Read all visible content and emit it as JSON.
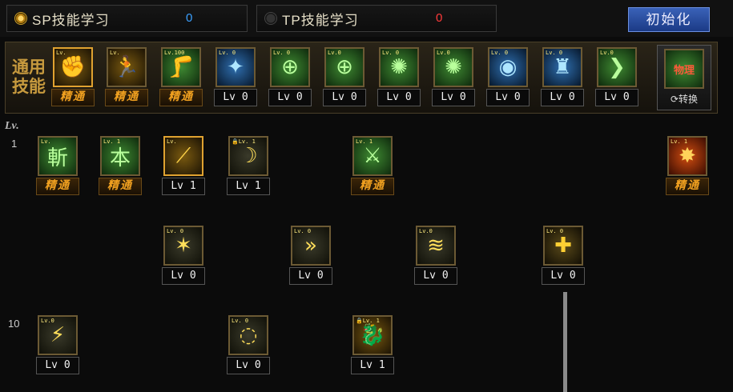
{
  "tabs": {
    "sp": {
      "label": "SP技能学习",
      "points": "0"
    },
    "tp": {
      "label": "TP技能学习",
      "points": "0"
    },
    "init_button": "初始化"
  },
  "colors": {
    "sp_points": "#3aa0ff",
    "tp_points": "#ff3a3a",
    "mastery": "#f0a020"
  },
  "common": {
    "label": "通用技能",
    "skills": [
      {
        "badge": "Lv.",
        "level": "精通",
        "icon": "fist-icon",
        "glyph": "✊",
        "style": "g-gold",
        "selected": true
      },
      {
        "badge": "Lv.",
        "level": "精通",
        "icon": "runner-icon",
        "glyph": "🏃",
        "style": "g-gold"
      },
      {
        "badge": "Lv.100",
        "level": "精通",
        "icon": "kick-icon",
        "glyph": "🦵",
        "style": "g-green"
      },
      {
        "badge": "Lv. 0",
        "level": "Lv 0",
        "icon": "wings-icon",
        "glyph": "✦",
        "style": "g-blue"
      },
      {
        "badge": "Lv. 0",
        "level": "Lv 0",
        "icon": "target-icon",
        "glyph": "⊕",
        "style": "g-green"
      },
      {
        "badge": "Lv.0",
        "level": "Lv 0",
        "icon": "target-icon",
        "glyph": "⊕",
        "style": "g-green"
      },
      {
        "badge": "Lv. 0",
        "level": "Lv 0",
        "icon": "fighter-icon",
        "glyph": "✺",
        "style": "g-green"
      },
      {
        "badge": "Lv.0",
        "level": "Lv 0",
        "icon": "fighter-icon",
        "glyph": "✺",
        "style": "g-green"
      },
      {
        "badge": "Lv. 0",
        "level": "Lv 0",
        "icon": "eye-icon",
        "glyph": "◉",
        "style": "g-blue"
      },
      {
        "badge": "Lv. 0",
        "level": "Lv 0",
        "icon": "body-icon",
        "glyph": "♜",
        "style": "g-blue"
      },
      {
        "badge": "Lv.0",
        "level": "Lv 0",
        "icon": "kick-icon",
        "glyph": "❯",
        "style": "g-green"
      }
    ],
    "switch": {
      "icon_text": "物理",
      "label": "⟳转换"
    }
  },
  "grid": {
    "lv_header": "Lv.",
    "row_labels": [
      "1",
      "10"
    ],
    "skills": [
      {
        "badge": "Lv.",
        "level": "精通",
        "icon": "slash-icon",
        "glyph": "斬",
        "style": "g-green"
      },
      {
        "badge": "Lv. 1",
        "level": "精通",
        "icon": "basic-icon",
        "glyph": "本",
        "style": "g-green"
      },
      {
        "badge": "Lv.",
        "level": "Lv 1",
        "icon": "blade-icon",
        "glyph": "⟋",
        "style": "g-gold",
        "selected": true
      },
      {
        "badge": "🔒Lv. 1",
        "level": "Lv 1",
        "icon": "crescent-icon",
        "glyph": "☽",
        "style": "g-dark"
      },
      {
        "badge": "Lv. 1",
        "level": "精通",
        "icon": "stance-icon",
        "glyph": "⚔",
        "style": "g-green"
      },
      {
        "badge": "Lv. 1",
        "level": "精通",
        "icon": "flame-icon",
        "glyph": "✸",
        "style": "g-fire"
      },
      {
        "badge": "Lv. 0",
        "level": "Lv 0",
        "icon": "burst-icon",
        "glyph": "✶",
        "style": "g-dark"
      },
      {
        "badge": "Lv. 0",
        "level": "Lv 0",
        "icon": "arrows-icon",
        "glyph": "»",
        "style": "g-dark"
      },
      {
        "badge": "Lv.0",
        "level": "Lv 0",
        "icon": "wave-icon",
        "glyph": "≋",
        "style": "g-dark"
      },
      {
        "badge": "Lv. 0",
        "level": "Lv 0",
        "icon": "shield-icon",
        "glyph": "✚",
        "style": "g-shield"
      },
      {
        "badge": "Lv.0",
        "level": "Lv 0",
        "icon": "lightning-icon",
        "glyph": "⚡",
        "style": "g-dark"
      },
      {
        "badge": "Lv. 0",
        "level": "Lv 0",
        "icon": "ring-icon",
        "glyph": "◌",
        "style": "g-dark"
      },
      {
        "badge": "🔒Lv. 1",
        "level": "Lv 1",
        "icon": "dragon-icon",
        "glyph": "🐉",
        "style": "g-gold"
      }
    ]
  }
}
